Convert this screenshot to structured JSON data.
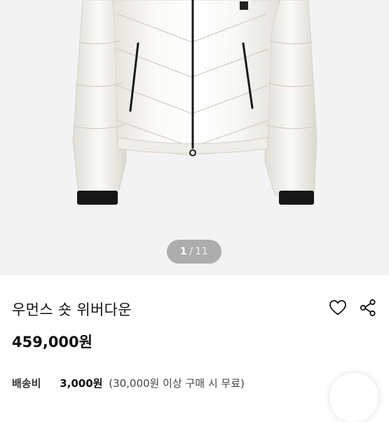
{
  "gallery": {
    "current": "1",
    "separator": "/",
    "total": "11"
  },
  "product": {
    "title": "우먼스 숏 위버다운",
    "price": "459,000원"
  },
  "shipping": {
    "label": "배송비",
    "fee": "3,000원",
    "note": "(30,000원 이상 구매 시 무료)"
  },
  "icons": {
    "like": "heart-outline-icon",
    "share": "share-icon"
  },
  "colors": {
    "photo_background": "#f3f3f3",
    "jacket": "#f7f6f2",
    "counter_pill": "#969696"
  }
}
